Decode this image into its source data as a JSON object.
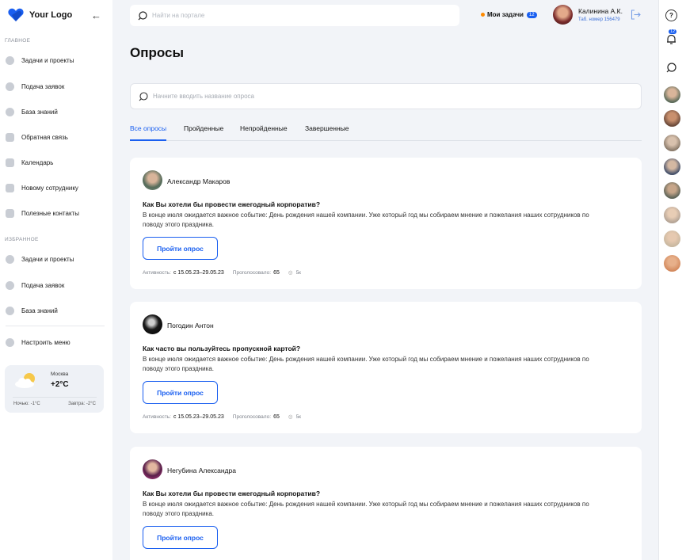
{
  "logo": {
    "text": "Your Logo"
  },
  "sidebar": {
    "main_label": "ГЛАВНОЕ",
    "main_items": [
      {
        "label": "Задачи и проекты",
        "icon": "tasks-icon"
      },
      {
        "label": "Подача заявок",
        "icon": "people-icon"
      },
      {
        "label": "База знаний",
        "icon": "knowledge-icon"
      },
      {
        "label": "Обратная связь",
        "icon": "feedback-icon"
      },
      {
        "label": "Календарь",
        "icon": "calendar-icon"
      },
      {
        "label": "Новому сотруднику",
        "icon": "newcomer-icon"
      },
      {
        "label": "Полезные контакты",
        "icon": "contacts-icon"
      }
    ],
    "fav_label": "ИЗБРАННОЕ",
    "fav_items": [
      {
        "label": "Задачи и проекты",
        "icon": "tasks-icon"
      },
      {
        "label": "Подача заявок",
        "icon": "people-icon"
      },
      {
        "label": "База знаний",
        "icon": "knowledge-icon"
      }
    ],
    "settings_label": "Настроить меню"
  },
  "weather": {
    "city": "Москва",
    "temp": "+2°C",
    "night": "Ночью: -1°C",
    "tomorrow": "Завтра: -2°C"
  },
  "topbar": {
    "search_placeholder": "Найти на портале",
    "tasks_label": "Мои задачи",
    "tasks_count": "12",
    "user_name": "Калинина А.К.",
    "user_tab": "Таб. номер 156479"
  },
  "rail": {
    "help": "?",
    "notifications_count": "12"
  },
  "page": {
    "title": "Опросы",
    "search_placeholder": "Начните вводить название опроса",
    "tabs": [
      "Все опросы",
      "Пройденные",
      "Непройденные",
      "Завершенные"
    ]
  },
  "polls": [
    {
      "author": "Александр Макаров",
      "question": "Как Вы хотели бы провести ежегодный корпоратив?",
      "description": "В конце июля ожидается важное событие: День рождения нашей компании. Уже который год мы собираем мнение и пожелания наших сотрудников по поводу этого праздника.",
      "button": "Пройти опрос",
      "activity_label": "Активность:",
      "activity": "с 15.05.23–29.05.23",
      "votes_label": "Проголосовало:",
      "votes": "65",
      "views": "5к"
    },
    {
      "author": "Погодин Антон",
      "question": "Как часто вы пользуйтесь пропускной картой?",
      "description": "В конце июля ожидается важное событие: День рождения нашей компании. Уже который год мы собираем мнение и пожелания наших сотрудников по поводу этого праздника.",
      "button": "Пройти опрос",
      "activity_label": "Активность:",
      "activity": "с 15.05.23–29.05.23",
      "votes_label": "Проголосовало:",
      "votes": "65",
      "views": "5к"
    },
    {
      "author": "Негубина Александра",
      "question": "Как Вы хотели бы провести ежегодный корпоратив?",
      "description": "В конце июля ожидается важное событие: День рождения нашей компании. Уже который год мы собираем мнение и пожелания наших сотрудников по поводу этого праздника.",
      "button": "Пройти опрос"
    }
  ],
  "colors": {
    "accent": "#1a5ff0",
    "tasks_dot": "#ff8a00",
    "background": "#f2f4f8"
  }
}
